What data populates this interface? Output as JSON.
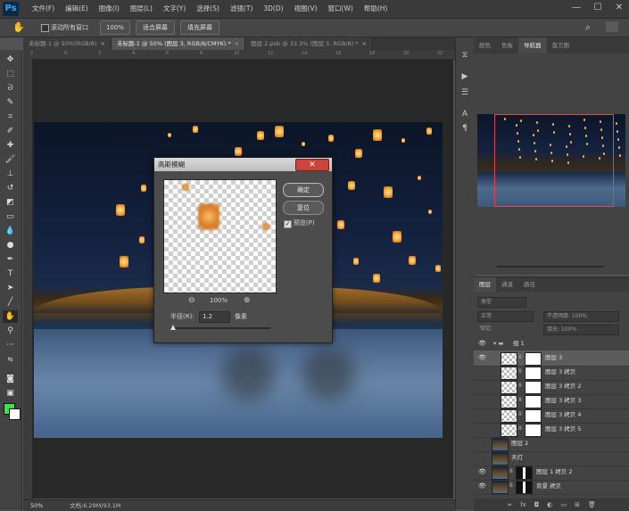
{
  "app": {
    "logo": "Ps"
  },
  "menu": [
    "文件(F)",
    "编辑(E)",
    "图像(I)",
    "图层(L)",
    "文字(Y)",
    "选择(S)",
    "滤镜(T)",
    "3D(D)",
    "视图(V)",
    "窗口(W)",
    "帮助(H)"
  ],
  "window_controls": {
    "minimize": "—",
    "maximize": "☐",
    "close": "✕"
  },
  "options": {
    "scroll_all_windows": "滚动所有窗口",
    "zoom_100": "100%",
    "fit_screen": "适合屏幕",
    "fill_screen": "填充屏幕"
  },
  "tabs": [
    {
      "label": "未标题-1 @ 50%(RGB/8)",
      "active": false
    },
    {
      "label": "未标题-1 @ 50% (图层 3, RGB/8/CMYK) *",
      "active": true
    },
    {
      "label": "图层 2.psb @ 33.3% (图层 3, RGB/8) *",
      "active": false
    }
  ],
  "ruler": {
    "top": [
      "2",
      "0",
      "2",
      "4",
      "6",
      "8",
      "10",
      "12",
      "14",
      "16",
      "18",
      "20",
      "22"
    ]
  },
  "dialog": {
    "title": "高斯模糊",
    "close": "✕",
    "ok": "确定",
    "reset": "复位",
    "preview_label": "预览(P)",
    "zoom_out": "⊖",
    "zoom": "100%",
    "zoom_in": "⊕",
    "radius_label": "半径(R):",
    "radius_value": "1.2",
    "unit": "像素",
    "preview_checked": true
  },
  "status": {
    "zoom": "50%",
    "doc": "文档:6.29M/93.1M"
  },
  "panel_tabs": {
    "nav": [
      "颜色",
      "色板",
      "导航器",
      "直方图"
    ],
    "active_nav": 2
  },
  "layers_tabs": [
    "图层",
    "通道",
    "路径"
  ],
  "layers_controls": {
    "kind": "类型",
    "blend": "正常",
    "opacity": "不透明度: 100%",
    "lock": "锁定:",
    "fill": "填充: 100%"
  },
  "layers": [
    {
      "name": "组 1",
      "type": "group",
      "visible": true,
      "selected": false
    },
    {
      "name": "图层 3",
      "type": "layer",
      "visible": true,
      "selected": true
    },
    {
      "name": "图层 3 拷贝",
      "type": "layer",
      "visible": false,
      "selected": false
    },
    {
      "name": "图层 3 拷贝 2",
      "type": "layer",
      "visible": false,
      "selected": false
    },
    {
      "name": "图层 3 拷贝 3",
      "type": "layer",
      "visible": false,
      "selected": false
    },
    {
      "name": "图层 3 拷贝 4",
      "type": "layer",
      "visible": false,
      "selected": false
    },
    {
      "name": "图层 3 拷贝 5",
      "type": "layer",
      "visible": false,
      "selected": false
    },
    {
      "name": "图层 2",
      "type": "photo",
      "visible": false,
      "selected": false
    },
    {
      "name": "天灯",
      "type": "photo",
      "visible": false,
      "selected": false
    },
    {
      "name": "图层 1 拷贝 2",
      "type": "photo-mask",
      "visible": true,
      "selected": false
    },
    {
      "name": "背景 拷贝",
      "type": "photo-mask",
      "visible": true,
      "selected": false
    }
  ],
  "colors": {
    "foreground": "#33e64a",
    "background": "#ffffff",
    "accent": "#e64545"
  }
}
